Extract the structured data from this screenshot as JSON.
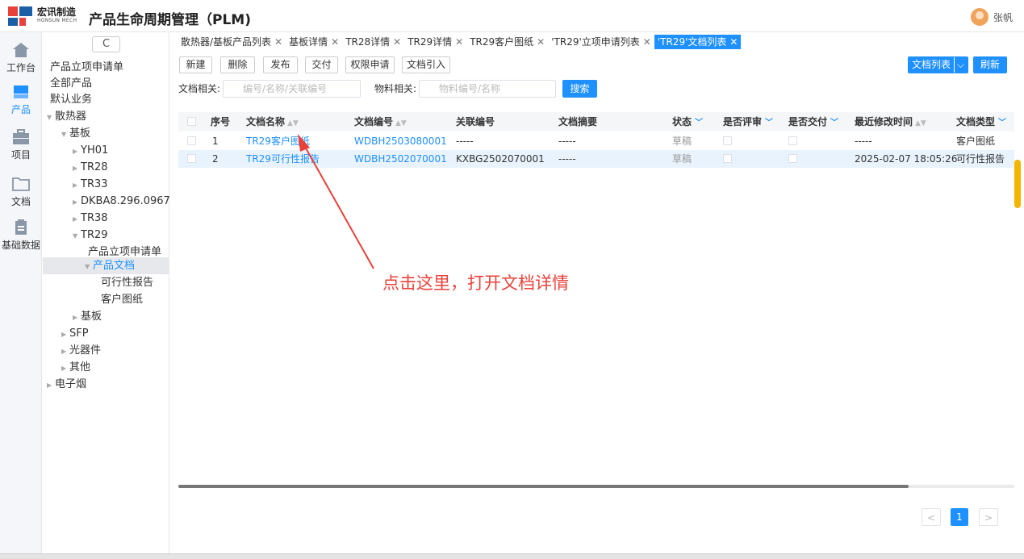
{
  "header": {
    "brand_cn": "宏讯制造",
    "brand_en": "HONSUN MECH",
    "app_title": "产品生命周期管理（PLM)",
    "user_name": "张帆"
  },
  "rail": [
    {
      "label": "工作台",
      "icon": "home-icon"
    },
    {
      "label": "产品",
      "icon": "product-icon"
    },
    {
      "label": "项目",
      "icon": "briefcase-icon"
    },
    {
      "label": "文档",
      "icon": "folder-icon"
    },
    {
      "label": "基础数据",
      "icon": "clipboard-icon"
    }
  ],
  "tree": {
    "refresh_glyph": "C",
    "nodes": [
      "产品立项申请单",
      "全部产品",
      "默认业务",
      "散热器",
      "基板",
      "YH01",
      "TR28",
      "TR33",
      "DKBA8.296.0967",
      "TR38",
      "TR29",
      "产品立项申请单",
      "产品文档",
      "可行性报告",
      "客户图纸",
      "基板",
      "SFP",
      "光器件",
      "其他",
      "电子烟"
    ]
  },
  "tabs": [
    {
      "label": "散热器/基板产品列表"
    },
    {
      "label": "基板详情"
    },
    {
      "label": "TR28详情"
    },
    {
      "label": "TR29详情"
    },
    {
      "label": "TR29客户图纸"
    },
    {
      "label": "'TR29'立项申请列表"
    },
    {
      "label": "'TR29'文档列表"
    }
  ],
  "toolbar": {
    "new": "新建",
    "delete": "删除",
    "publish": "发布",
    "deliver": "交付",
    "permission": "权限申请",
    "import": "文档引入",
    "view_select": "文档列表",
    "refresh": "刷新"
  },
  "filters": {
    "doc_label": "文档相关:",
    "doc_placeholder": "编号/名称/关联编号",
    "mat_label": "物料相关:",
    "mat_placeholder": "物料编号/名称",
    "search": "搜索"
  },
  "table": {
    "headers": [
      "序号",
      "文档名称",
      "文档编号",
      "关联编号",
      "文档摘要",
      "状态",
      "是否评审",
      "是否交付",
      "最近修改时间",
      "文档类型"
    ],
    "rows": [
      {
        "no": "1",
        "name": "TR29客户图纸",
        "code": "WDBH2503080001",
        "rel": "-----",
        "summary": "-----",
        "status": "草稿",
        "mtime": "-----",
        "type": "客户图纸"
      },
      {
        "no": "2",
        "name": "TR29可行性报告",
        "code": "WDBH2502070001",
        "rel": "KXBG2502070001",
        "summary": "-----",
        "status": "草稿",
        "mtime": "2025-02-07 18:05:26",
        "type": "可行性报告"
      }
    ]
  },
  "pagination": {
    "prev": "<",
    "current": "1",
    "next": ">"
  },
  "annotation": "点击这里，打开文档详情"
}
